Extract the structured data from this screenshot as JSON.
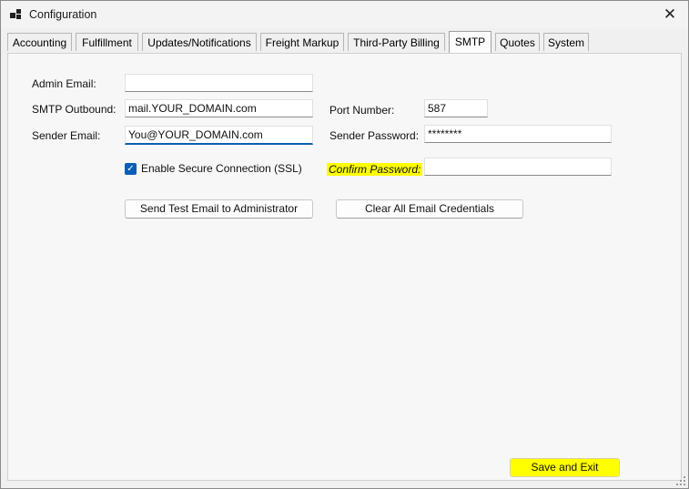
{
  "window": {
    "title": "Configuration",
    "app_icon": "app-window-icon",
    "close_glyph": "✕"
  },
  "tabs": [
    {
      "label": "Accounting",
      "active": false
    },
    {
      "label": "Fulfillment",
      "active": false
    },
    {
      "label": "Updates/Notifications",
      "active": false
    },
    {
      "label": "Freight Markup",
      "active": false
    },
    {
      "label": "Third-Party Billing",
      "active": false
    },
    {
      "label": "SMTP",
      "active": true
    },
    {
      "label": "Quotes",
      "active": false
    },
    {
      "label": "System",
      "active": false
    }
  ],
  "smtp": {
    "admin_email": {
      "label": "Admin Email:",
      "value": ""
    },
    "smtp_outbound": {
      "label": "SMTP Outbound:",
      "value": "mail.YOUR_DOMAIN.com"
    },
    "port_number": {
      "label": "Port Number:",
      "value": "587"
    },
    "sender_email": {
      "label": "Sender Email:",
      "value": "You@YOUR_DOMAIN.com"
    },
    "sender_password": {
      "label": "Sender Password:",
      "value": "********"
    },
    "ssl": {
      "label": "Enable Secure Connection (SSL)",
      "checked": true,
      "check_glyph": "✓"
    },
    "confirm_password": {
      "label": "Confirm Password:",
      "value": ""
    },
    "send_test_button": "Send Test Email to Administrator",
    "clear_credentials_button": "Clear All Email Credentials"
  },
  "footer": {
    "save_exit_button": "Save and Exit"
  },
  "colors": {
    "accent": "#0a5fb4",
    "highlight": "#ffff00",
    "background": "#f0f0f0"
  }
}
